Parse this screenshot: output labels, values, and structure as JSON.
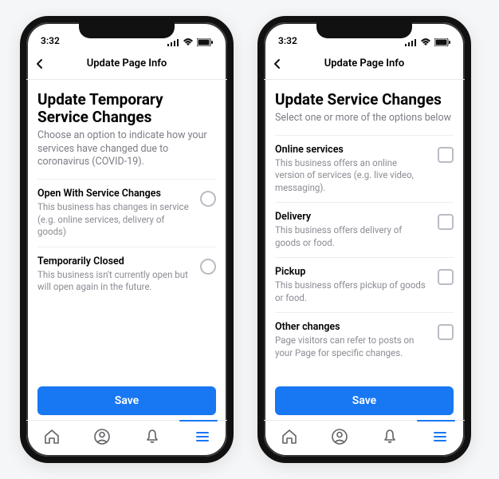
{
  "status": {
    "time": "3:32"
  },
  "left": {
    "nav_title": "Update Page Info",
    "page_title": "Update Temporary Service Changes",
    "page_subtitle": "Choose an option to indicate how your services have changed due to coronavirus (COVID-19).",
    "options": [
      {
        "title": "Open With Service Changes",
        "desc": "This business has changes in service (e.g. online services, delivery of goods)"
      },
      {
        "title": "Temporarily Closed",
        "desc": "This business isn't currently open but will open again in the future."
      }
    ],
    "save_label": "Save"
  },
  "right": {
    "nav_title": "Update Page Info",
    "page_title": "Update Service Changes",
    "page_subtitle": "Select one or more of the options below",
    "options": [
      {
        "title": "Online services",
        "desc": "This business offers an online version of services (e.g. live video, messaging)."
      },
      {
        "title": "Delivery",
        "desc": "This business offers delivery of goods or food."
      },
      {
        "title": "Pickup",
        "desc": "This business offers pickup of goods or food."
      },
      {
        "title": "Other changes",
        "desc": "Page visitors can refer to posts on your Page for specific changes."
      }
    ],
    "save_label": "Save"
  },
  "colors": {
    "accent": "#1877f2"
  }
}
